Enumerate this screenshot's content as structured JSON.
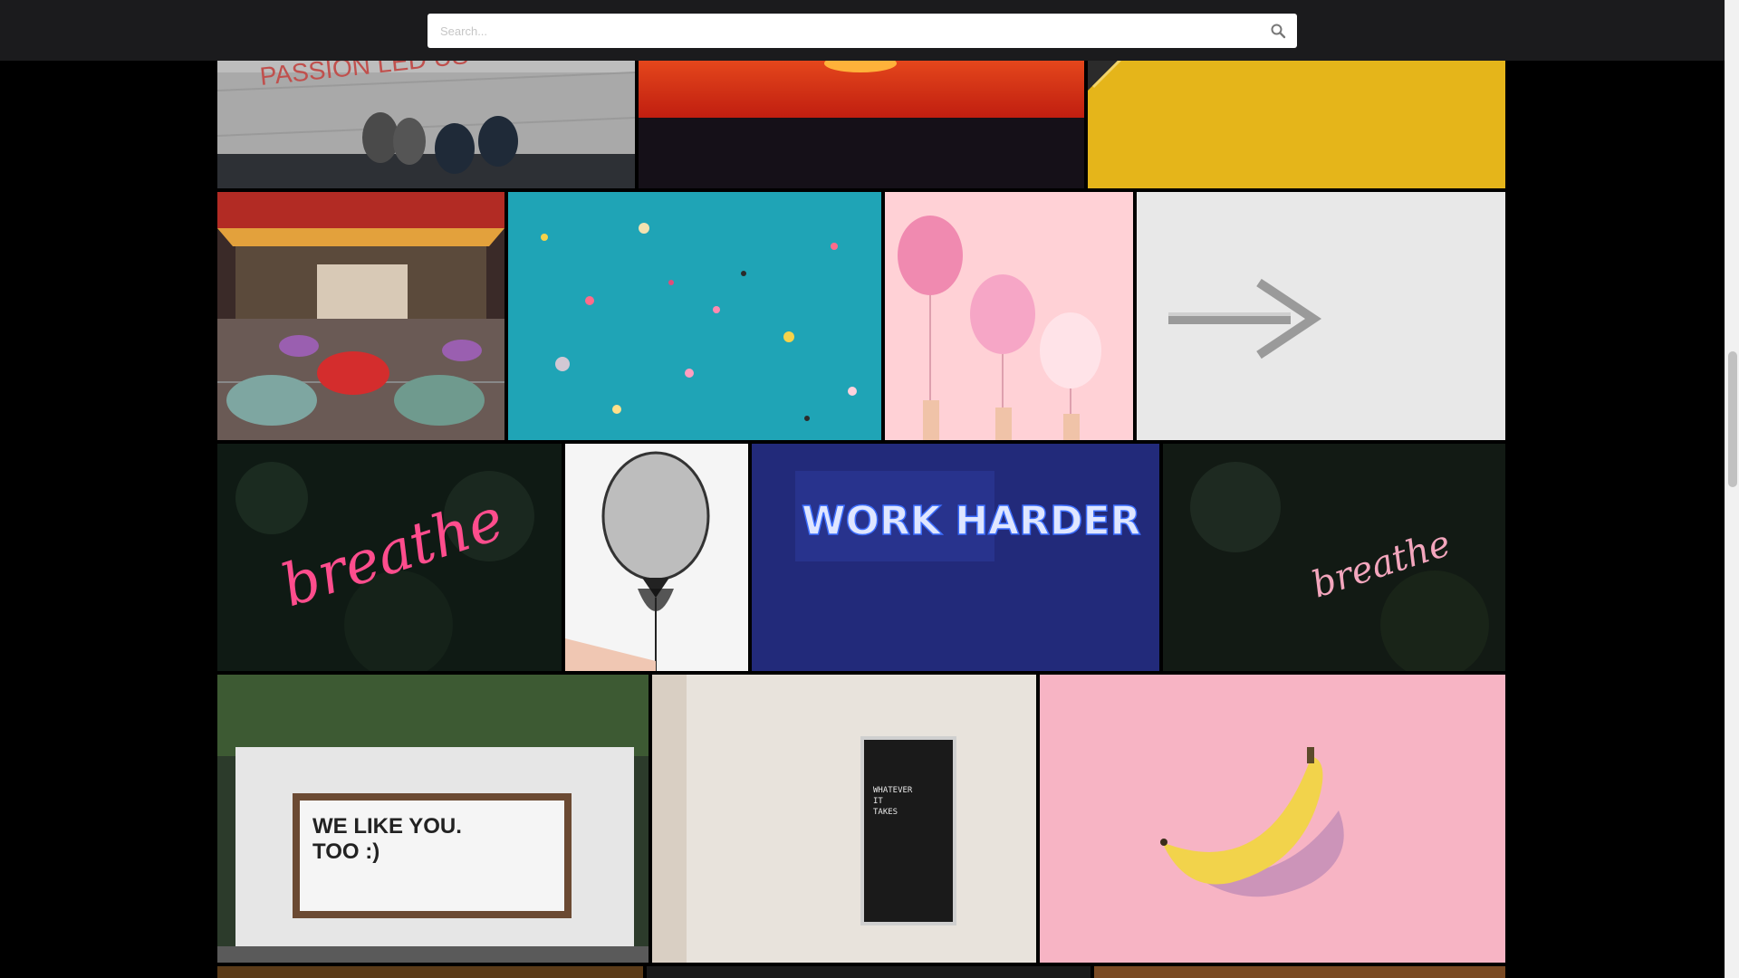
{
  "search": {
    "placeholder": "Search..."
  },
  "gallery": {
    "photos": [
      {
        "name": "passion-led-us-shoes",
        "text": "PASSION LED US"
      },
      {
        "name": "red-sunset",
        "text": ""
      },
      {
        "name": "yellow-wall",
        "text": ""
      },
      {
        "name": "bumper-cars",
        "text": ""
      },
      {
        "name": "confetti-teal",
        "text": ""
      },
      {
        "name": "pink-balloons",
        "text": ""
      },
      {
        "name": "arrow-on-wall",
        "text": ""
      },
      {
        "name": "breathe-neon-left",
        "text": "breathe"
      },
      {
        "name": "black-balloon",
        "text": ""
      },
      {
        "name": "work-harder-neon",
        "text": "WORK HARDER"
      },
      {
        "name": "breathe-neon-right",
        "text": "breathe"
      },
      {
        "name": "we-like-you-too-sign",
        "text_line1": "WE LIKE YOU.",
        "text_line2": "TOO :)"
      },
      {
        "name": "whatever-it-takes-board",
        "text_line1": "WHATEVER",
        "text_line2": "IT",
        "text_line3": "TAKES"
      },
      {
        "name": "banana-on-pink",
        "text": ""
      }
    ]
  },
  "colors": {
    "topbar": "#1b1b1d",
    "background": "#000000",
    "neon_pink": "#ff4d8d",
    "neon_blue": "#3b6dff"
  }
}
